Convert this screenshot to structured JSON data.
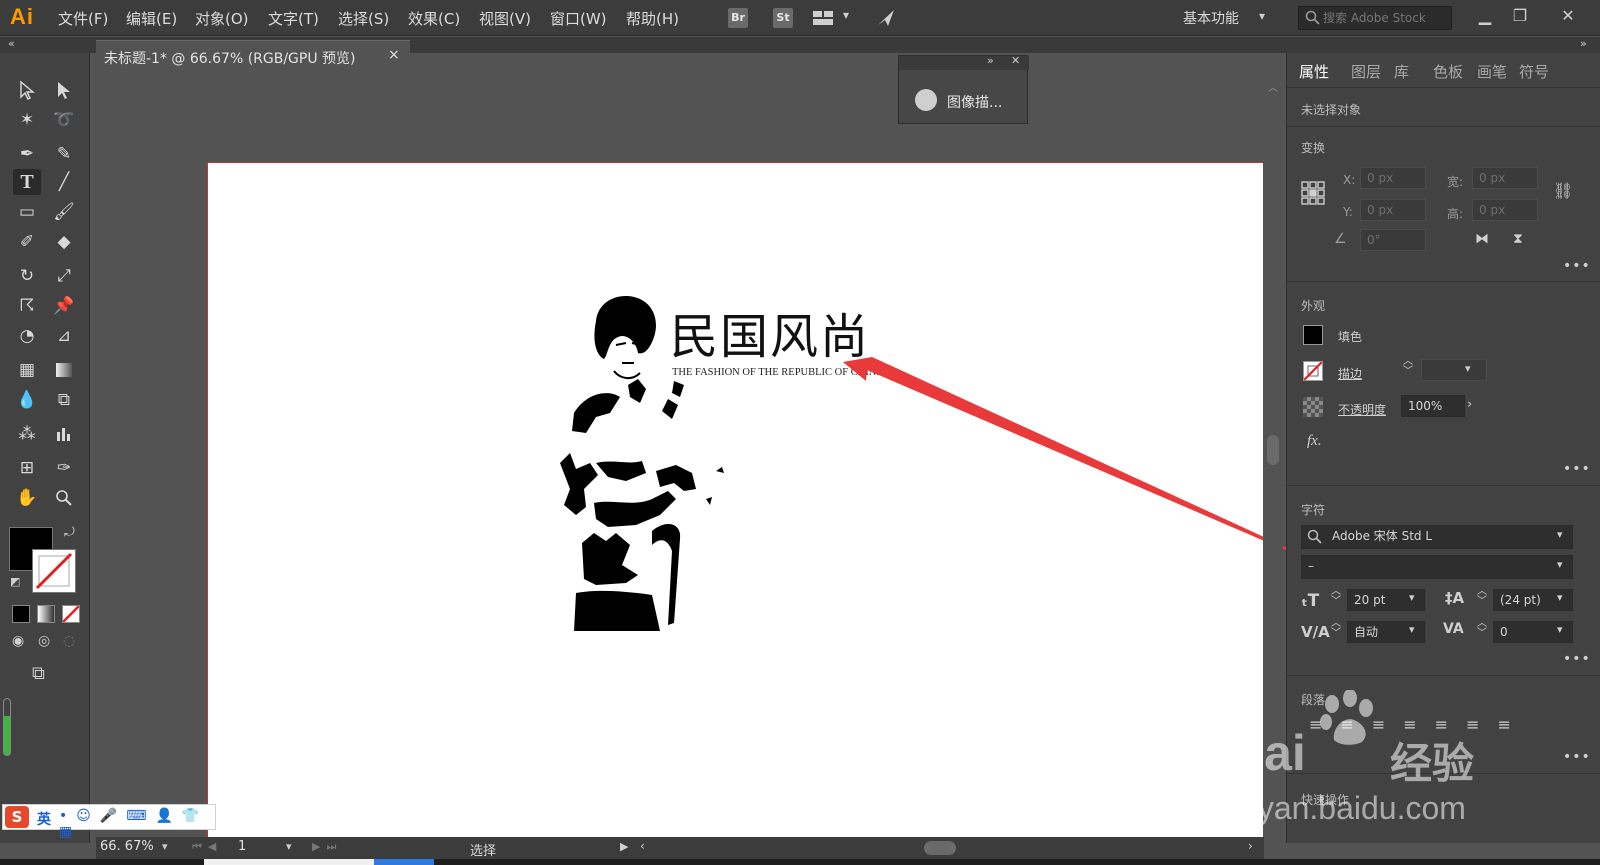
{
  "app": {
    "logo": "Ai"
  },
  "menu": [
    "文件(F)",
    "编辑(E)",
    "对象(O)",
    "文字(T)",
    "选择(S)",
    "效果(C)",
    "视图(V)",
    "窗口(W)",
    "帮助(H)"
  ],
  "bridge_buttons": [
    "Br",
    "St"
  ],
  "workspace": {
    "label": "基本功能"
  },
  "stock_search": {
    "placeholder": "搜索 Adobe Stock"
  },
  "document": {
    "tab_title": "未标题-1* @ 66.67% (RGB/GPU 预览)",
    "close": "×"
  },
  "trace_panel": {
    "label": "图像描..."
  },
  "artwork": {
    "title": "民国风尚",
    "subtitle": "THE FASHION OF THE REPUBLIC OF CHINA"
  },
  "panel": {
    "tabs": [
      "属性",
      "图层",
      "库",
      "色板",
      "画笔",
      "符号"
    ],
    "selection_status": "未选择对象",
    "transform": {
      "title": "变换",
      "x_label": "X:",
      "x_value": "0 px",
      "y_label": "Y:",
      "y_value": "0 px",
      "w_label": "宽:",
      "w_value": "0 px",
      "h_label": "高:",
      "h_value": "0 px",
      "angle_value": "0°"
    },
    "appearance": {
      "title": "外观",
      "fill_label": "填色",
      "stroke_label": "描边",
      "opacity_label": "不透明度",
      "opacity_value": "100%",
      "fx_label": "fx."
    },
    "character": {
      "title": "字符",
      "font_family": "Adobe 宋体 Std L",
      "font_style": "–",
      "font_size": "20 pt",
      "leading": "(24 pt)",
      "kerning": "自动",
      "tracking": "0"
    },
    "paragraph": {
      "title": "段落"
    },
    "quick_actions": {
      "title": "快速操作"
    }
  },
  "status": {
    "zoom": "66. 67%",
    "page": "1",
    "tool": "选择"
  },
  "ime": {
    "mode": "英"
  },
  "watermark": {
    "brand": "Bai",
    "brand2": "经验",
    "url": "jingyan.baidu.com"
  },
  "colors": {
    "accent_arrow": "#e83a3a",
    "logo": "#ff9a00",
    "artboard_border": "#c53232"
  }
}
